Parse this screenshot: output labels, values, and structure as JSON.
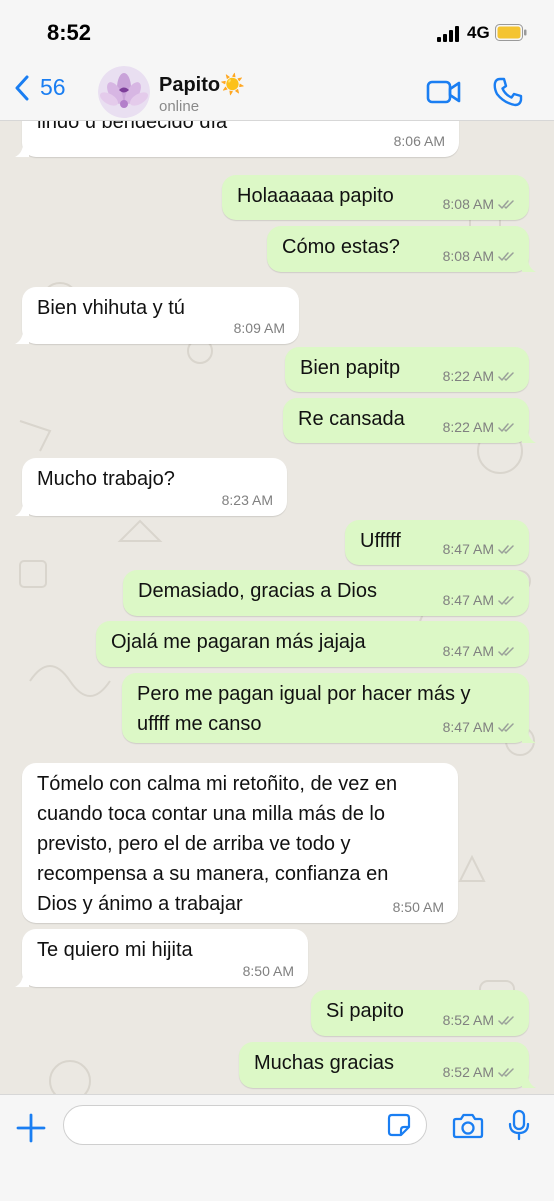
{
  "status_bar": {
    "time": "8:52",
    "network": "4G"
  },
  "header": {
    "back_count": "56",
    "contact_name": "Papito",
    "contact_emoji": "☀️",
    "contact_status": "online"
  },
  "colors": {
    "accent": "#1a7ef2",
    "incoming": "#ffffff",
    "outgoing": "#dcf8c6",
    "wallpaper": "#ebe8e2"
  },
  "messages": [
    {
      "dir": "in",
      "text": "lindo u bendecido día",
      "time": "8:06 AM"
    },
    {
      "dir": "out",
      "text": "Holaaaaaa papito",
      "time": "8:08 AM"
    },
    {
      "dir": "out",
      "text": "Cómo estas?",
      "time": "8:08 AM"
    },
    {
      "dir": "in",
      "text": "Bien vhihuta y tú",
      "time": "8:09 AM"
    },
    {
      "dir": "out",
      "text": "Bien papitp",
      "time": "8:22 AM"
    },
    {
      "dir": "out",
      "text": "Re cansada",
      "time": "8:22 AM"
    },
    {
      "dir": "in",
      "text": "Mucho trabajo?",
      "time": "8:23 AM"
    },
    {
      "dir": "out",
      "text": "Ufffff",
      "time": "8:47 AM"
    },
    {
      "dir": "out",
      "text": "Demasiado, gracias a Dios",
      "time": "8:47 AM"
    },
    {
      "dir": "out",
      "text": "Ojalá me pagaran más jajaja",
      "time": "8:47 AM"
    },
    {
      "dir": "out",
      "text": "Pero me pagan igual por hacer más y\nuffff me canso",
      "time": "8:47 AM"
    },
    {
      "dir": "in",
      "text": "Tómelo con calma mi retoñito, de vez en\ncuando toca contar una milla más de lo\nprevisto, pero el de arriba ve todo y\nrecompensa a su manera, confianza en\nDios y ánimo a trabajar",
      "time": "8:50 AM"
    },
    {
      "dir": "in",
      "text": "Te quiero mi hijita",
      "time": "8:50 AM"
    },
    {
      "dir": "out",
      "text": "Si papito",
      "time": "8:52 AM"
    },
    {
      "dir": "out",
      "text": "Muchas gracias",
      "time": "8:52 AM"
    }
  ],
  "input": {
    "value": "",
    "placeholder": ""
  }
}
